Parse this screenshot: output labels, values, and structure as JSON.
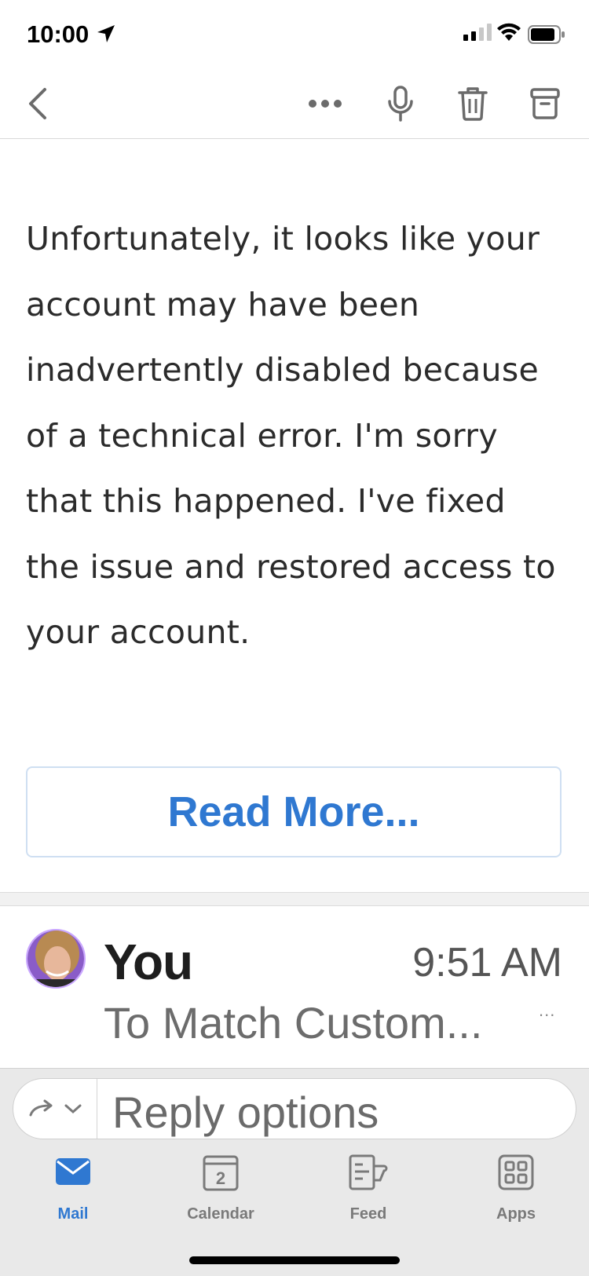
{
  "status_bar": {
    "time": "10:00"
  },
  "toolbar": {
    "back": "back",
    "more": "more",
    "voice": "microphone",
    "delete": "trash",
    "archive": "archive"
  },
  "message": {
    "body": "Unfortunately, it looks like your account may have been inadvertently disabled because of a technical error. I'm sorry that this happened. I've fixed the issue and restored access to your account.",
    "read_more": "Read More..."
  },
  "next_message": {
    "sender": "You",
    "time": "9:51 AM",
    "recipients": "To Match Custom...",
    "more": "..."
  },
  "reply": {
    "placeholder": "Reply options"
  },
  "tabs": [
    {
      "label": "Mail",
      "icon": "mail-icon",
      "active": true
    },
    {
      "label": "Calendar",
      "icon": "calendar-icon",
      "badge": "2",
      "active": false
    },
    {
      "label": "Feed",
      "icon": "feed-icon",
      "active": false
    },
    {
      "label": "Apps",
      "icon": "apps-icon",
      "active": false
    }
  ],
  "colors": {
    "accent": "#2f78d1",
    "readmore_border": "#cfdff2"
  }
}
